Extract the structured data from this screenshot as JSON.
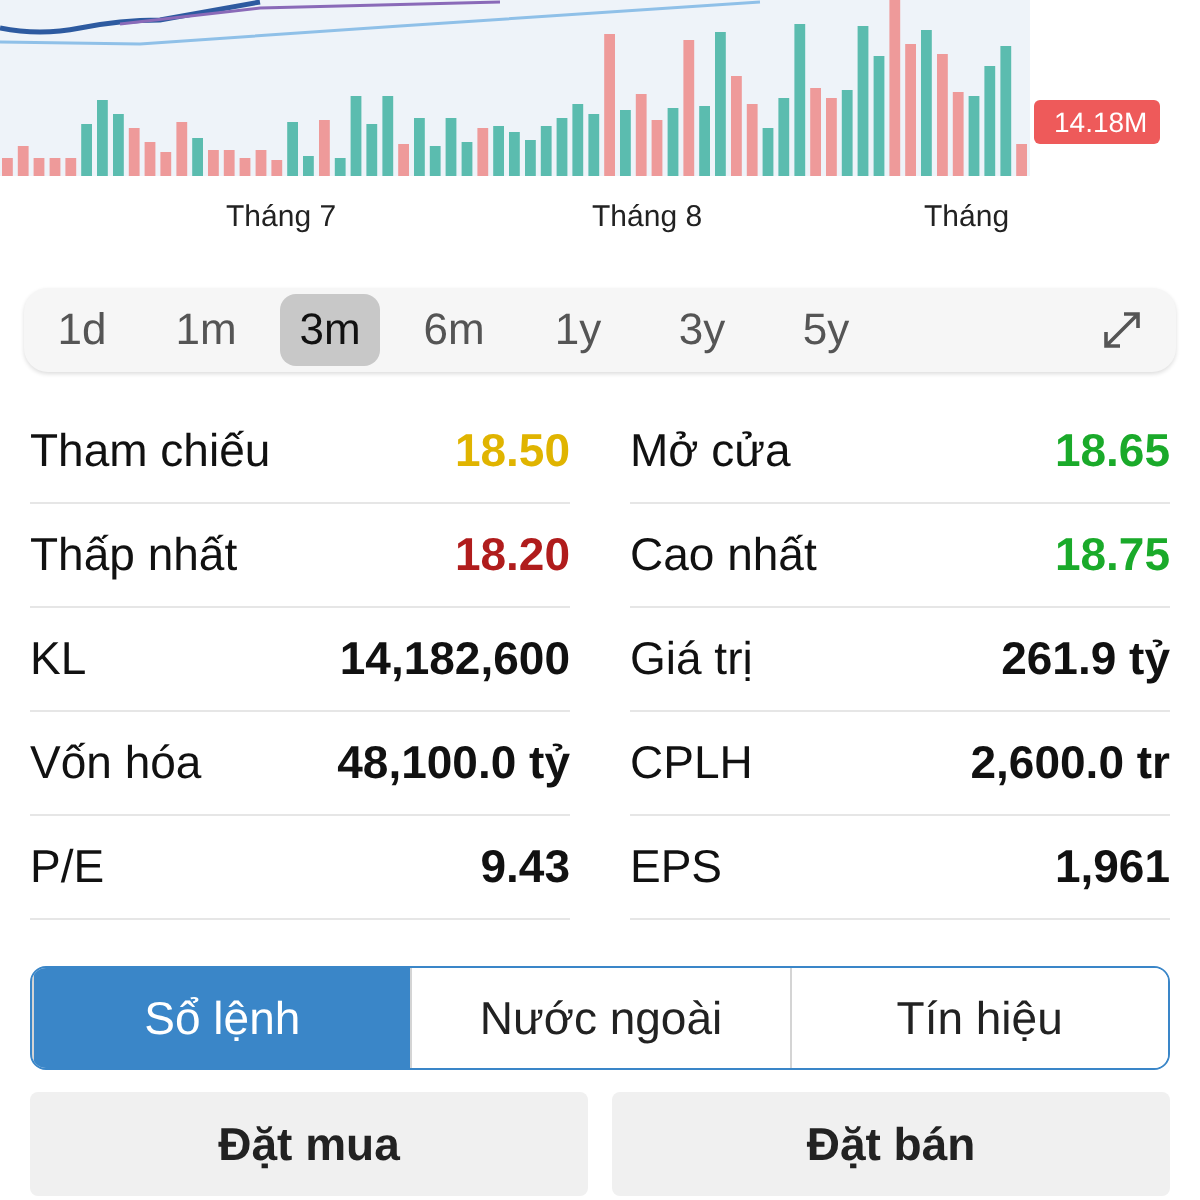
{
  "chart": {
    "volume_badge": "14.18M",
    "months": [
      "Tháng 7",
      "Tháng 8",
      "Tháng"
    ]
  },
  "periods": [
    {
      "label": "1d",
      "selected": false
    },
    {
      "label": "1m",
      "selected": false
    },
    {
      "label": "3m",
      "selected": true
    },
    {
      "label": "6m",
      "selected": false
    },
    {
      "label": "1y",
      "selected": false
    },
    {
      "label": "3y",
      "selected": false
    },
    {
      "label": "5y",
      "selected": false
    }
  ],
  "stats": [
    {
      "label": "Tham chiếu",
      "value": "18.50",
      "color": "#e0b400"
    },
    {
      "label": "Mở cửa",
      "value": "18.65",
      "color": "#1aaa2a"
    },
    {
      "label": "Thấp nhất",
      "value": "18.20",
      "color": "#b01c1c"
    },
    {
      "label": "Cao nhất",
      "value": "18.75",
      "color": "#1aaa2a"
    },
    {
      "label": "KL",
      "value": "14,182,600",
      "color": "#111111"
    },
    {
      "label": "Giá trị",
      "value": "261.9 tỷ",
      "color": "#111111"
    },
    {
      "label": "Vốn hóa",
      "value": "48,100.0 tỷ",
      "color": "#111111"
    },
    {
      "label": "CPLH",
      "value": "2,600.0 tr",
      "color": "#111111"
    },
    {
      "label": "P/E",
      "value": "9.43",
      "color": "#111111"
    },
    {
      "label": "EPS",
      "value": "1,961",
      "color": "#111111"
    }
  ],
  "tabs": [
    {
      "label": "Sổ lệnh",
      "selected": true
    },
    {
      "label": "Nước ngoài",
      "selected": false
    },
    {
      "label": "Tín hiệu",
      "selected": false
    }
  ],
  "buttons": [
    "Đặt mua",
    "Đặt bán"
  ]
}
